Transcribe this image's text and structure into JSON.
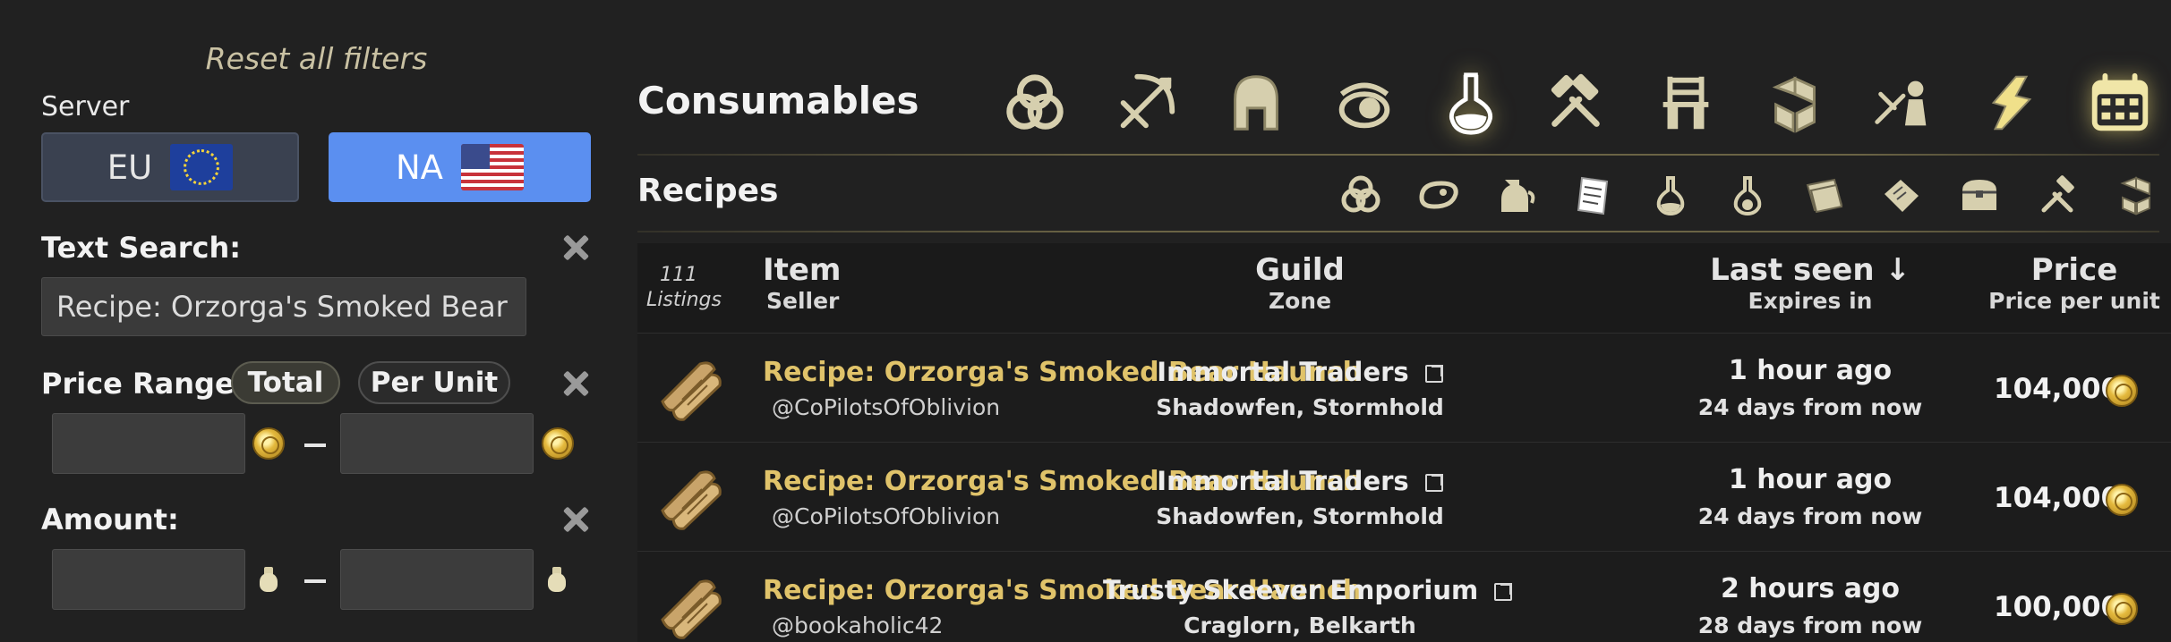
{
  "filters": {
    "reset_label": "Reset all filters",
    "server_label": "Server",
    "servers": [
      {
        "label": "EU",
        "flag": "eu-flag-icon",
        "selected": false
      },
      {
        "label": "NA",
        "flag": "us-flag-icon",
        "selected": true
      }
    ],
    "text_search_label": "Text Search:",
    "text_search_value": "Recipe: Orzorga's Smoked Bear Haunch",
    "price_range_label": "Price Range:",
    "price_modes": [
      "Total",
      "Per Unit"
    ],
    "price_mode_selected": "Total",
    "price_min": "",
    "price_max": "",
    "amount_label": "Amount:",
    "amount_min": "",
    "amount_max": ""
  },
  "category": {
    "title": "Consumables",
    "icons": [
      "all-categories-icon",
      "weapons-icon",
      "armor-icon",
      "jewelry-icon",
      "consumables-icon",
      "crafting-icon",
      "furnishing-icon",
      "materials-icon",
      "companion-icon",
      "quest-icon",
      "calendar-icon"
    ],
    "active": "consumables-icon"
  },
  "subcategory": {
    "title": "Recipes",
    "icons": [
      "all-subcategories-icon",
      "food-icon",
      "drink-icon",
      "recipes-icon",
      "potions-icon",
      "poisons-icon",
      "motifs-icon",
      "writs-icon",
      "containers-icon",
      "repair-icon",
      "misc-icon"
    ],
    "active": "recipes-icon"
  },
  "table": {
    "listings_count": "111",
    "listings_label": "Listings",
    "columns": {
      "item": "Item",
      "seller": "Seller",
      "guild": "Guild",
      "zone": "Zone",
      "last_seen": "Last seen ↓",
      "expires": "Expires in",
      "price": "Price",
      "price_per_unit": "Price per unit"
    },
    "rows": [
      {
        "item": "Recipe: Orzorga's Smoked Bear Haunch",
        "seller": "@CoPilotsOfOblivion",
        "guild": "Immortal Traders",
        "zone": "Shadowfen, Stormhold",
        "last_seen": "1 hour ago",
        "expires": "24 days from now",
        "price": "104,000"
      },
      {
        "item": "Recipe: Orzorga's Smoked Bear Haunch",
        "seller": "@CoPilotsOfOblivion",
        "guild": "Immortal Traders",
        "zone": "Shadowfen, Stormhold",
        "last_seen": "1 hour ago",
        "expires": "24 days from now",
        "price": "104,000"
      },
      {
        "item": "Recipe: Orzorga's Smoked Bear Haunch",
        "seller": "@bookaholic42",
        "guild": "Trusty Skeever Emporium",
        "zone": "Craglorn, Belkarth",
        "last_seen": "2 hours ago",
        "expires": "28 days from now",
        "price": "100,000"
      }
    ]
  },
  "colors": {
    "background": "#212121",
    "accent_blue": "#5b8ff0",
    "item_gold": "#e0c36a",
    "icon_cream": "#d6cfae"
  }
}
